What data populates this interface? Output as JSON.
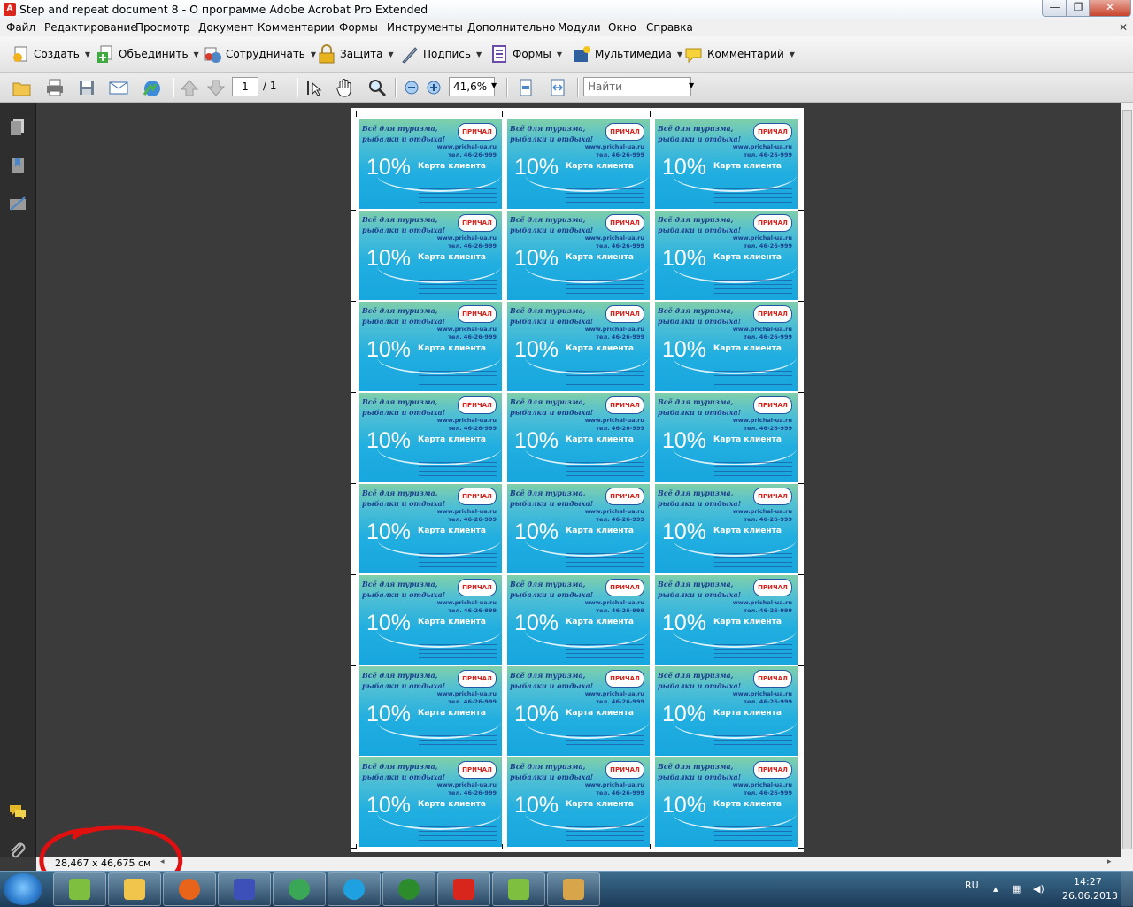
{
  "window": {
    "title": "Step and repeat document 8 - О программе Adobe Acrobat Pro Extended",
    "min": "—",
    "max": "❐",
    "close": "✕"
  },
  "menu": [
    "Файл",
    "Редактирование",
    "Просмотр",
    "Документ",
    "Комментарии",
    "Формы",
    "Инструменты",
    "Дополнительно",
    "Модули",
    "Окно",
    "Справка"
  ],
  "menu_close": "✕",
  "toolbar1": [
    {
      "label": "Создать",
      "icon": "create-pdf-icon"
    },
    {
      "label": "Объединить",
      "icon": "combine-icon"
    },
    {
      "label": "Сотрудничать",
      "icon": "collaborate-icon"
    },
    {
      "label": "Защита",
      "icon": "lock-icon"
    },
    {
      "label": "Подпись",
      "icon": "pen-icon"
    },
    {
      "label": "Формы",
      "icon": "forms-icon"
    },
    {
      "label": "Мультимедиа",
      "icon": "multimedia-icon"
    },
    {
      "label": "Комментарий",
      "icon": "comment-icon"
    }
  ],
  "toolbar2": {
    "page_current": "1",
    "page_total": "/ 1",
    "zoom": "41,6%",
    "find_placeholder": "Найти"
  },
  "card": {
    "slogan_line1": "Всё для туризма,",
    "slogan_line2": "рыбалки и отдыха!",
    "logo": "ПРИЧАЛ",
    "site": "www.prichal-ua.ru",
    "phone": "тел. 46-26-999",
    "percent": "10%",
    "card_label": "Карта клиента"
  },
  "grid": {
    "rows": 8,
    "cols": 3
  },
  "status": {
    "page_size": "28,467 x 46,675 см"
  },
  "annotation": {
    "color": "#e01010"
  },
  "taskbar": {
    "apps": [
      "corel-draw-icon",
      "explorer-icon",
      "firefox-icon",
      "bridge-icon",
      "chrome-icon",
      "skype-icon",
      "utorrent-icon",
      "acrobat-icon",
      "corel-draw-icon",
      "paint-icon"
    ],
    "lang": "RU",
    "time": "14:27",
    "date": "26.06.2013"
  }
}
